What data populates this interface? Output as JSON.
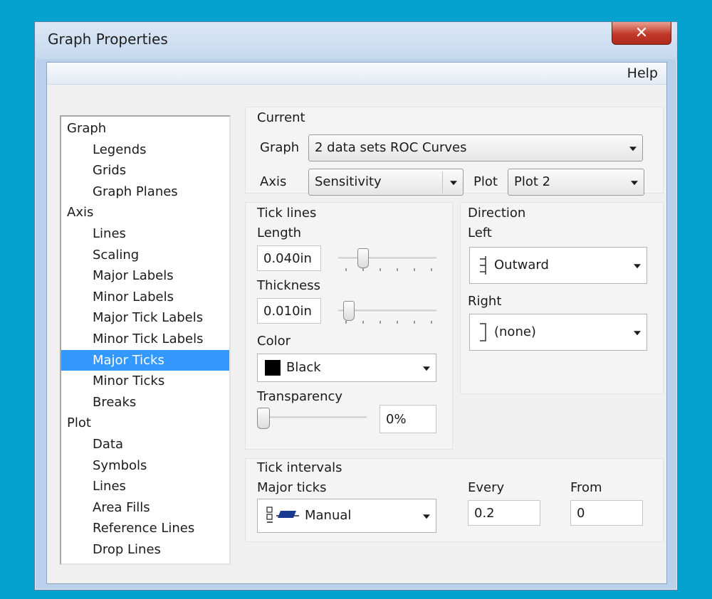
{
  "window": {
    "title": "Graph Properties",
    "close_glyph": "✕"
  },
  "menu": {
    "help": "Help"
  },
  "tree": [
    {
      "label": "Graph",
      "level": 0
    },
    {
      "label": "Legends",
      "level": 1
    },
    {
      "label": "Grids",
      "level": 1
    },
    {
      "label": "Graph Planes",
      "level": 1
    },
    {
      "label": "Axis",
      "level": 0
    },
    {
      "label": "Lines",
      "level": 1
    },
    {
      "label": "Scaling",
      "level": 1
    },
    {
      "label": "Major Labels",
      "level": 1
    },
    {
      "label": "Minor Labels",
      "level": 1
    },
    {
      "label": "Major Tick Labels",
      "level": 1
    },
    {
      "label": "Minor Tick Labels",
      "level": 1
    },
    {
      "label": "Major Ticks",
      "level": 1,
      "selected": true
    },
    {
      "label": "Minor Ticks",
      "level": 1
    },
    {
      "label": "Breaks",
      "level": 1
    },
    {
      "label": "Plot",
      "level": 0
    },
    {
      "label": "Data",
      "level": 1
    },
    {
      "label": "Symbols",
      "level": 1
    },
    {
      "label": "Lines",
      "level": 1
    },
    {
      "label": "Area Fills",
      "level": 1
    },
    {
      "label": "Reference Lines",
      "level": 1
    },
    {
      "label": "Drop Lines",
      "level": 1
    }
  ],
  "current": {
    "header": "Current",
    "graph_label": "Graph",
    "graph_value": "2 data sets ROC Curves",
    "axis_label": "Axis",
    "axis_value": "Sensitivity",
    "plot_label": "Plot",
    "plot_value": "Plot 2"
  },
  "tick_lines": {
    "header": "Tick lines",
    "length_label": "Length",
    "length_value": "0.040in",
    "length_level": 0.22,
    "thickness_label": "Thickness",
    "thickness_value": "0.010in",
    "thickness_level": 0.06,
    "color_label": "Color",
    "color_value": "Black",
    "color_hex": "#000000",
    "transparency_label": "Transparency",
    "transparency_value": "0%",
    "transparency_level": 0
  },
  "direction": {
    "header": "Direction",
    "left_label": "Left",
    "left_value": "Outward",
    "right_label": "Right",
    "right_value": "(none)"
  },
  "tick_intervals": {
    "header": "Tick intervals",
    "major_label": "Major ticks",
    "major_value": "Manual",
    "every_label": "Every",
    "every_value": "0.2",
    "from_label": "From",
    "from_value": "0"
  }
}
